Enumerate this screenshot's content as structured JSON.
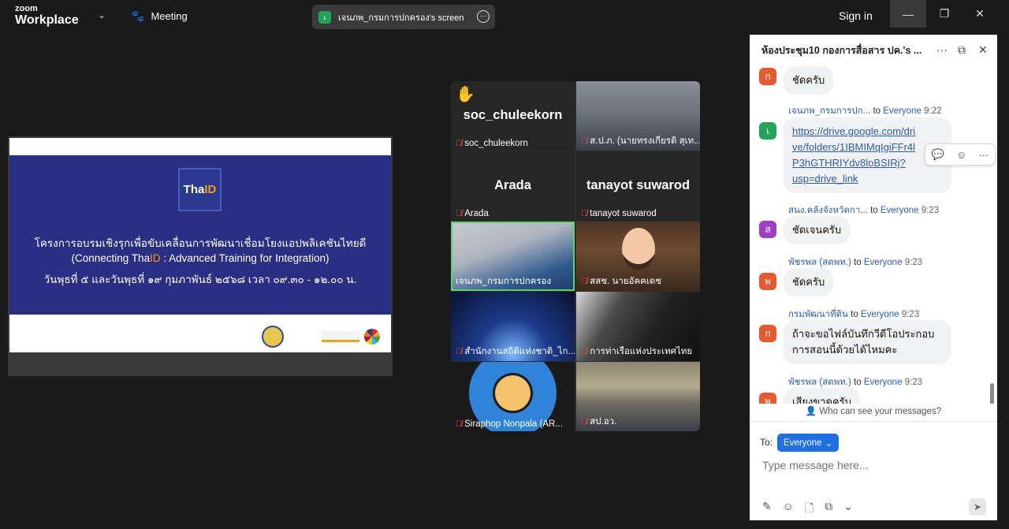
{
  "app": {
    "logo_line1": "zoom",
    "logo_line2": "Workplace",
    "meeting_label": "Meeting",
    "sign_in": "Sign in"
  },
  "share": {
    "label": "เจนภพ_กรมการปกครอง's screen",
    "dot": "เ"
  },
  "slide": {
    "logo_a": "Tha",
    "logo_b": "ID",
    "line1": "โครงการอบรมเชิงรุกเพื่อขับเคลื่อนการพัฒนาเชื่อมโยงแอปพลิเคชันไทยดี",
    "line2_a": "(Connecting Tha",
    "line2_b": "ID",
    "line2_c": " : Advanced Training for Integration)",
    "line3": "วันพุธที่ ๕ และวันพุธที่ ๑๙ กุมภาพันธ์ ๒๕๖๘ เวลา ๐๙.๓๐ - ๑๒.๐๐ น."
  },
  "gallery": [
    {
      "name": "soc_chuleekorn",
      "big": "soc_chuleekorn",
      "hand": "✋"
    },
    {
      "name": "ส.ป.ภ. (นายทรงเกียรติ สุเท..."
    },
    {
      "name": "Arada",
      "big": "Arada"
    },
    {
      "name": "tanayot suwarod",
      "big": "tanayot suwarod"
    },
    {
      "name": "เจนภพ_กรมการปกครอง"
    },
    {
      "name": "สสช. นายอัคคเดช"
    },
    {
      "name": "สำนักงานสถิติแห่งชาติ_ไก..."
    },
    {
      "name": "การท่าเรือแห่งประเทศไทย"
    },
    {
      "name": "Siraphop Nonpala (AR..."
    },
    {
      "name": "สป.อว."
    }
  ],
  "chat": {
    "title": "ห้องประชุม10 กองการสื่อสาร ปค.'s ...",
    "messages": [
      {
        "avatar": "ก",
        "color": "#e65a2e",
        "text": "ชัดครับ"
      },
      {
        "avatar": "เ",
        "color": "#22a55b",
        "sender": "เจนภพ_กรมการปก...",
        "to": "to",
        "audience": "Everyone",
        "time": "9:22",
        "link_lines": [
          "https://drive.google.com/dri",
          "ve/folders/1IBMIMqIgiFFr4l",
          "P3hGTHRIYdv8loBSIRj?",
          "usp=drive_link"
        ]
      },
      {
        "avatar": "ส",
        "color": "#9b3fc4",
        "sender": "สนง.คลังจังหวัดกา...",
        "to": "to",
        "audience": "Everyone",
        "time": "9:23",
        "text": "ชัดเจนครับ"
      },
      {
        "avatar": "พ",
        "color": "#e65a2e",
        "sender": "พัชรพล (สตพท.)",
        "to": "to",
        "audience": "Everyone",
        "time": "9:23",
        "text": "ชัดครับ"
      },
      {
        "avatar": "ก",
        "color": "#e65a2e",
        "sender": "กรมพัฒนาที่ดิน",
        "to": "to",
        "audience": "Everyone",
        "time": "9:23",
        "text1": "ถ้าจะขอไฟล์บันทึกวีดีโอประกอบ",
        "text2": "การสอนนี้ด้วยได้ไหมคะ"
      },
      {
        "avatar": "พ",
        "color": "#e65a2e",
        "sender": "พัชรพล (สตพท.)",
        "to": "to",
        "audience": "Everyone",
        "time": "9:23",
        "text": "เสียงขาดครับ"
      }
    ],
    "who_can_see": "Who can see your messages?",
    "to_label": "To:",
    "recipient": "Everyone",
    "placeholder": "Type message here..."
  },
  "colors": {
    "accent": "#1f6fe5",
    "link": "#2b5cb8",
    "active_speaker": "#5ad36b",
    "muted": "#e34a4a"
  }
}
